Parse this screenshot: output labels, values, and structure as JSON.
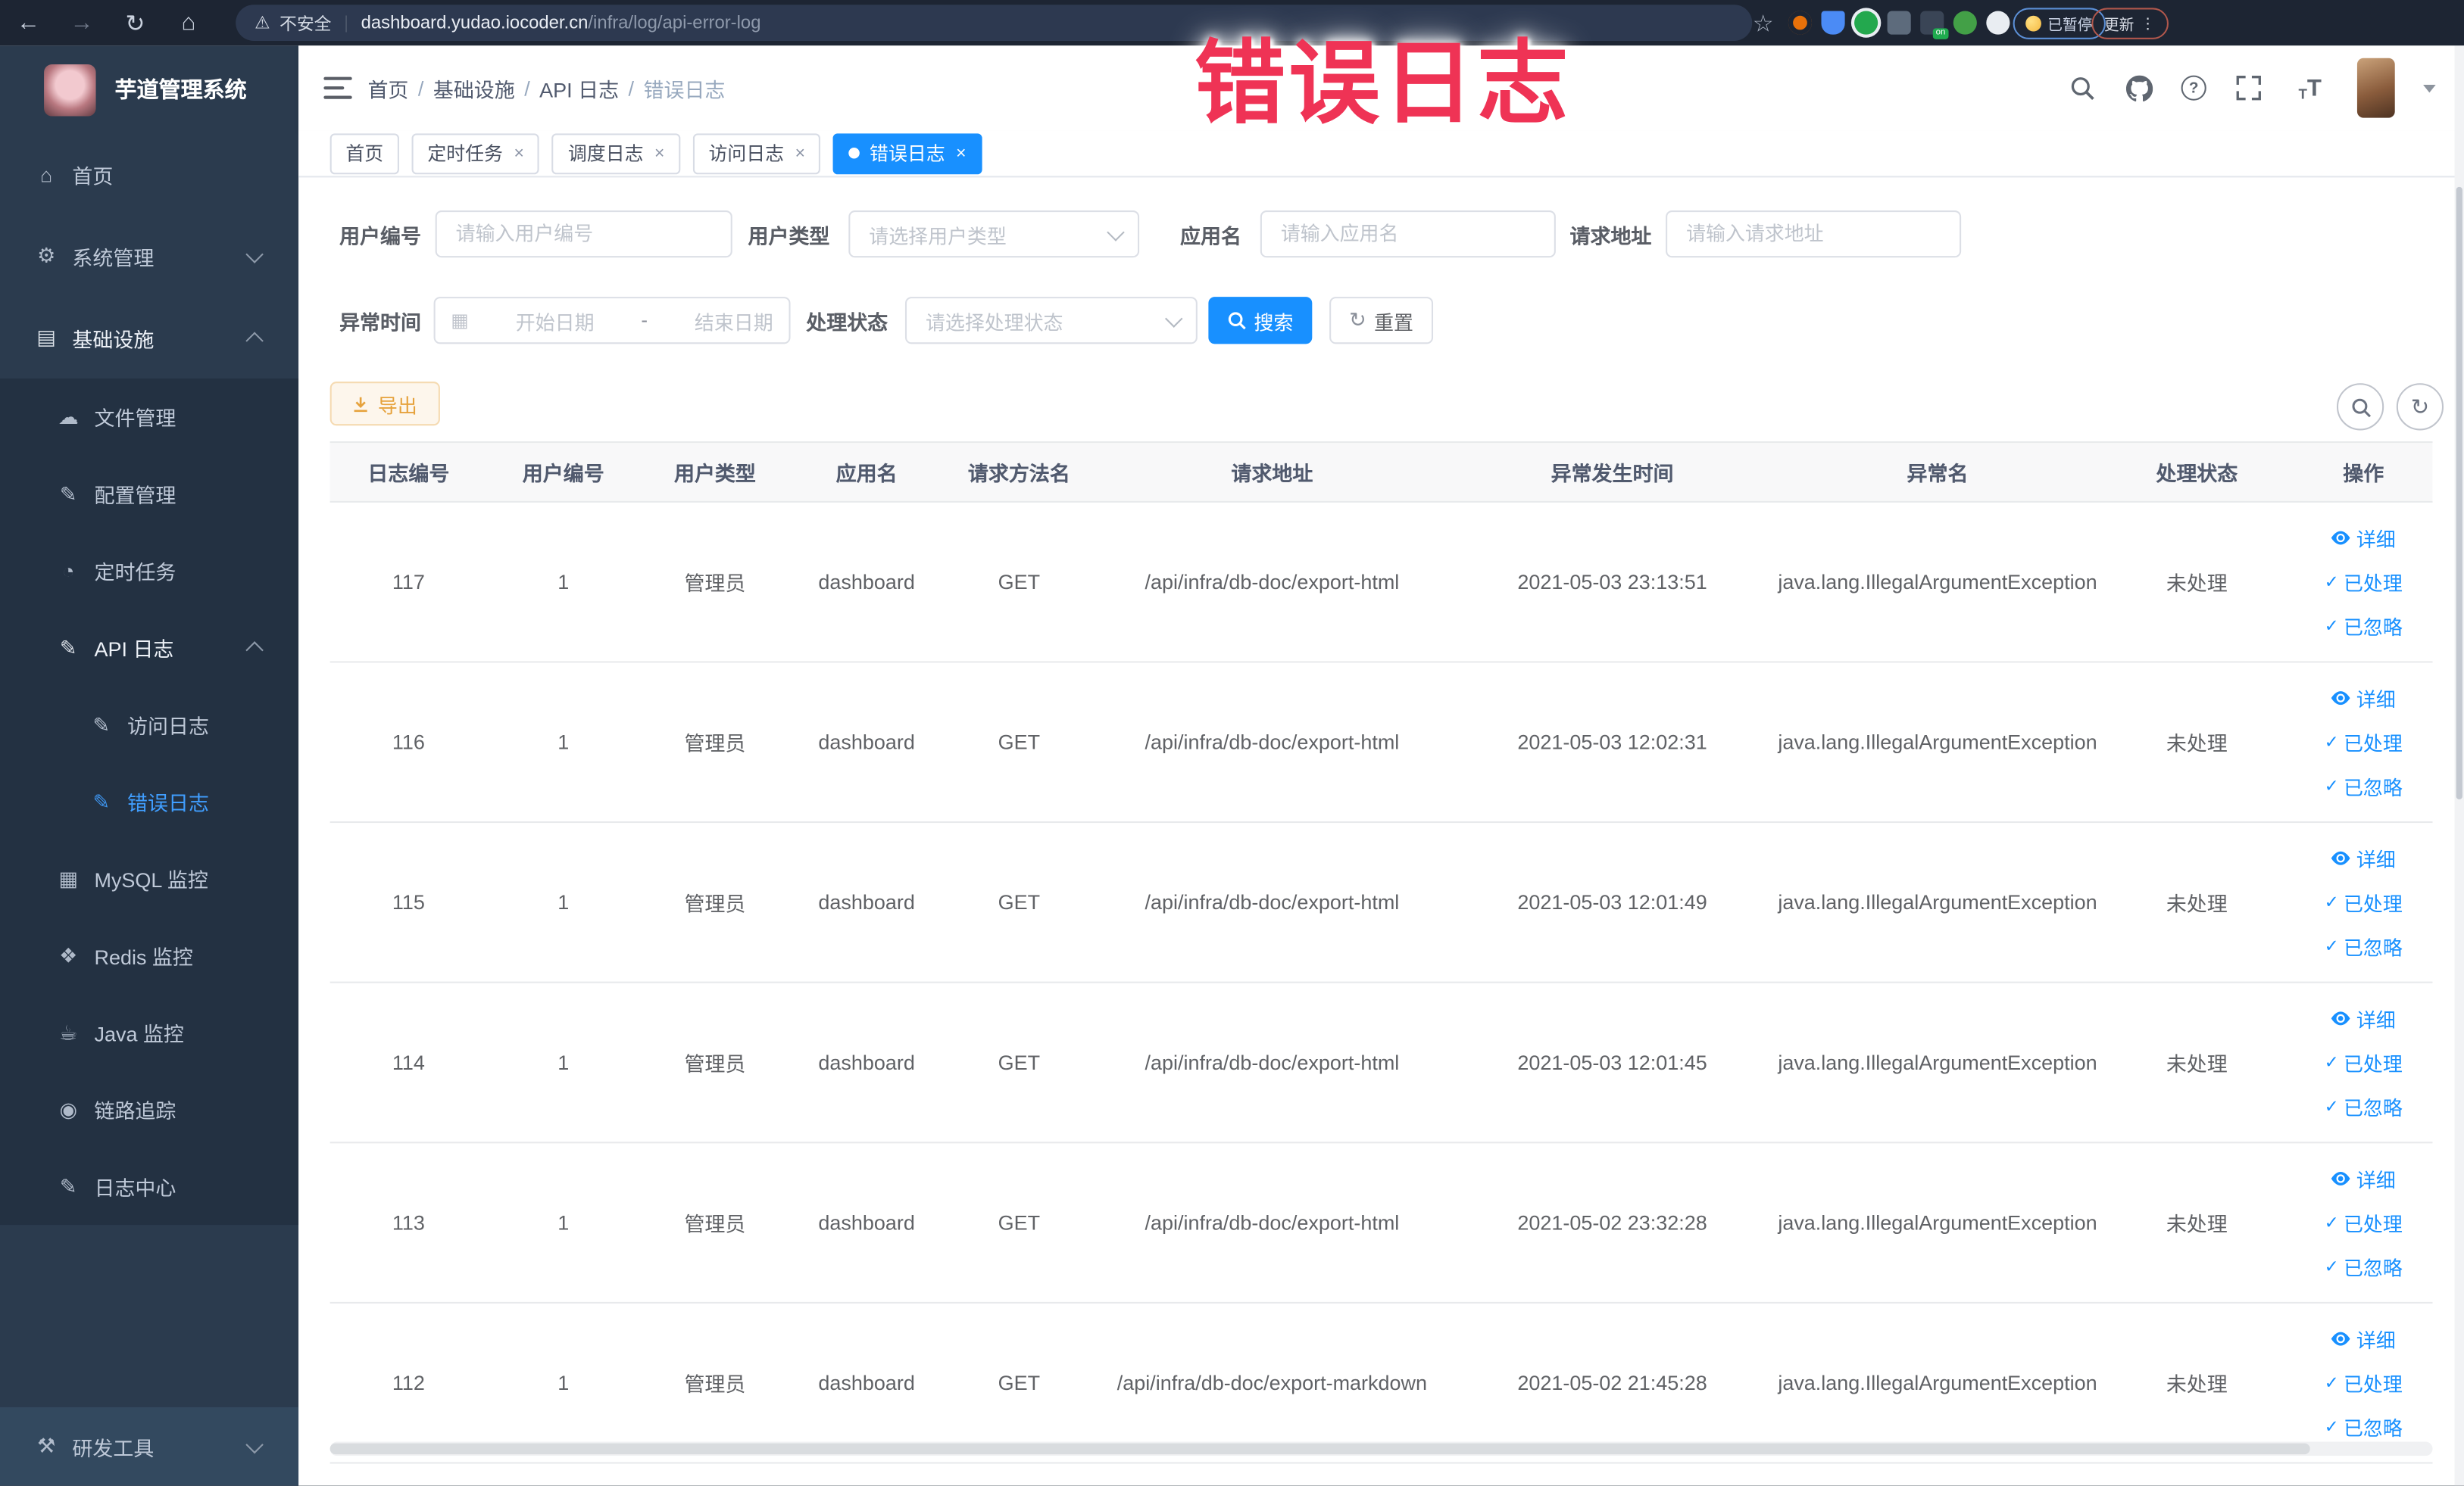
{
  "browser": {
    "security_label": "不安全",
    "url_host": "dashboard.yudao.iocoder.cn",
    "url_path": "/infra/log/api-error-log",
    "paused_badge": "已暂停",
    "update_badge": "更新",
    "extensions": [
      {
        "name": "extension-orange-ring",
        "color": "#e8710a"
      },
      {
        "name": "extension-blue-shield",
        "color": "#4b8bf5"
      },
      {
        "name": "extension-green-circle",
        "color": "#23a84e"
      },
      {
        "name": "extension-grid",
        "color": "#5d6b7c"
      },
      {
        "name": "extension-list",
        "color": "#3a4556",
        "badge": "on"
      },
      {
        "name": "extension-sprout",
        "color": "#43a047"
      },
      {
        "name": "extension-puzzle",
        "color": "#e9edf2"
      }
    ]
  },
  "overlay": {
    "text": "错误日志",
    "color": "#ef3355"
  },
  "sidebar": {
    "title": "芋道管理系统",
    "items": [
      {
        "icon": "home-icon",
        "label": "首页",
        "level": 0
      },
      {
        "icon": "gear-icon",
        "label": "系统管理",
        "level": 0,
        "chevron": "down"
      },
      {
        "icon": "monitor-icon",
        "label": "基础设施",
        "level": 0,
        "chevron": "up",
        "bright": true
      },
      {
        "icon": "cloud-icon",
        "label": "文件管理",
        "level": 1
      },
      {
        "icon": "edit-icon",
        "label": "配置管理",
        "level": 1
      },
      {
        "icon": "timer-icon",
        "label": "定时任务",
        "level": 1
      },
      {
        "icon": "edit-icon",
        "label": "API 日志",
        "level": 1,
        "chevron": "up",
        "bright": true
      },
      {
        "icon": "edit-icon",
        "label": "访问日志",
        "level": 2
      },
      {
        "icon": "edit-icon",
        "label": "错误日志",
        "level": 2,
        "active": true
      },
      {
        "icon": "chart-icon",
        "label": "MySQL 监控",
        "level": 1
      },
      {
        "icon": "layers-icon",
        "label": "Redis 监控",
        "level": 1
      },
      {
        "icon": "java-icon",
        "label": "Java 监控",
        "level": 1
      },
      {
        "icon": "eye-icon",
        "label": "链路追踪",
        "level": 1
      },
      {
        "icon": "log-icon",
        "label": "日志中心",
        "level": 1
      },
      {
        "icon": "tools-icon",
        "label": "研发工具",
        "level": 0,
        "chevron": "down",
        "section": "dev"
      }
    ]
  },
  "topbar": {
    "breadcrumb": [
      "首页",
      "基础设施",
      "API 日志",
      "错误日志"
    ]
  },
  "tabs": [
    {
      "label": "首页",
      "closable": false,
      "active": false
    },
    {
      "label": "定时任务",
      "closable": true,
      "active": false
    },
    {
      "label": "调度日志",
      "closable": true,
      "active": false
    },
    {
      "label": "访问日志",
      "closable": true,
      "active": false
    },
    {
      "label": "错误日志",
      "closable": true,
      "active": true
    }
  ],
  "filters": {
    "user_id": {
      "label": "用户编号",
      "placeholder": "请输入用户编号"
    },
    "user_type": {
      "label": "用户类型",
      "placeholder": "请选择用户类型"
    },
    "app_name": {
      "label": "应用名",
      "placeholder": "请输入应用名"
    },
    "request_url": {
      "label": "请求地址",
      "placeholder": "请输入请求地址"
    },
    "exception_time": {
      "label": "异常时间",
      "start_placeholder": "开始日期",
      "separator": "-",
      "end_placeholder": "结束日期"
    },
    "process_status": {
      "label": "处理状态",
      "placeholder": "请选择处理状态"
    },
    "search_label": "搜索",
    "reset_label": "重置"
  },
  "toolbar": {
    "export_label": "导出"
  },
  "table": {
    "columns": [
      "日志编号",
      "用户编号",
      "用户类型",
      "应用名",
      "请求方法名",
      "请求地址",
      "异常发生时间",
      "异常名",
      "处理状态",
      "操作"
    ],
    "actions": [
      "详细",
      "已处理",
      "已忽略"
    ],
    "rows": [
      {
        "id": "117",
        "user_id": "1",
        "user_type": "管理员",
        "app": "dashboard",
        "method": "GET",
        "url": "/api/infra/db-doc/export-html",
        "time": "2021-05-03 23:13:51",
        "exception": "java.lang.IllegalArgumentException",
        "status": "未处理"
      },
      {
        "id": "116",
        "user_id": "1",
        "user_type": "管理员",
        "app": "dashboard",
        "method": "GET",
        "url": "/api/infra/db-doc/export-html",
        "time": "2021-05-03 12:02:31",
        "exception": "java.lang.IllegalArgumentException",
        "status": "未处理"
      },
      {
        "id": "115",
        "user_id": "1",
        "user_type": "管理员",
        "app": "dashboard",
        "method": "GET",
        "url": "/api/infra/db-doc/export-html",
        "time": "2021-05-03 12:01:49",
        "exception": "java.lang.IllegalArgumentException",
        "status": "未处理"
      },
      {
        "id": "114",
        "user_id": "1",
        "user_type": "管理员",
        "app": "dashboard",
        "method": "GET",
        "url": "/api/infra/db-doc/export-html",
        "time": "2021-05-03 12:01:45",
        "exception": "java.lang.IllegalArgumentException",
        "status": "未处理"
      },
      {
        "id": "113",
        "user_id": "1",
        "user_type": "管理员",
        "app": "dashboard",
        "method": "GET",
        "url": "/api/infra/db-doc/export-html",
        "time": "2021-05-02 23:32:28",
        "exception": "java.lang.IllegalArgumentException",
        "status": "未处理"
      },
      {
        "id": "112",
        "user_id": "1",
        "user_type": "管理员",
        "app": "dashboard",
        "method": "GET",
        "url": "/api/infra/db-doc/export-markdown",
        "time": "2021-05-02 21:45:28",
        "exception": "java.lang.IllegalArgumentException",
        "status": "未处理"
      }
    ]
  },
  "colors": {
    "accent": "#1890ff",
    "sidebar_active": "#409eff",
    "warning": "#e6a23c"
  }
}
